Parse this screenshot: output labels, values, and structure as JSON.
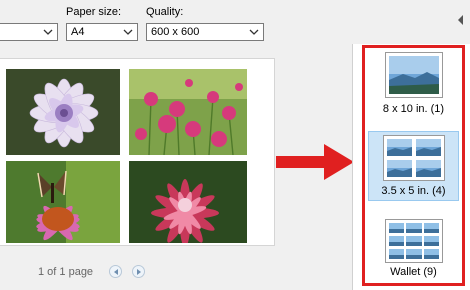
{
  "settings": {
    "paper_size_label": "Paper size:",
    "paper_size_value": "A4",
    "quality_label": "Quality:",
    "quality_value": "600 x 600"
  },
  "preview": {
    "pager_text": "1 of 1 page"
  },
  "layouts": [
    {
      "label": "8 x 10 in. (1)"
    },
    {
      "label": "3.5 x 5 in. (4)"
    },
    {
      "label": "Wallet (9)"
    }
  ],
  "colors": {
    "highlight": "#e02020",
    "selection": "#cce4f7"
  }
}
